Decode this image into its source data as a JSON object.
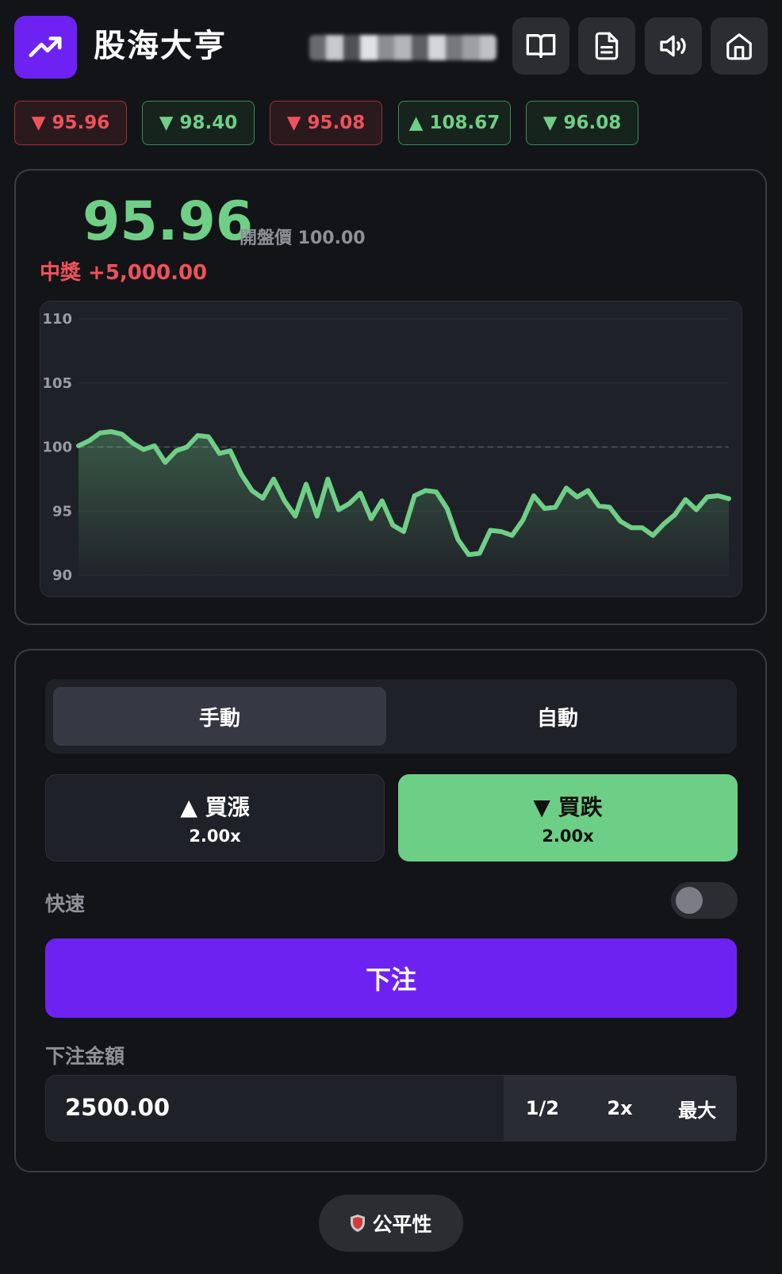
{
  "header": {
    "title": "股海大亨",
    "logo_icon": "trending-up-icon",
    "buttons": [
      {
        "icon": "book-open-icon"
      },
      {
        "icon": "document-icon"
      },
      {
        "icon": "volume-icon"
      },
      {
        "icon": "home-icon"
      }
    ]
  },
  "history": [
    {
      "text": "▼ 95.96",
      "dir": "down"
    },
    {
      "text": "▼ 98.40",
      "dir": "up"
    },
    {
      "text": "▼ 95.08",
      "dir": "down"
    },
    {
      "text": "▲ 108.67",
      "dir": "up"
    },
    {
      "text": "▼ 96.08",
      "dir": "up"
    }
  ],
  "price": {
    "current": "95.96",
    "open_label": "開盤價 100.00",
    "win_label": "中獎 +5,000.00"
  },
  "chart_data": {
    "type": "area",
    "ylim": [
      90,
      110
    ],
    "yticks": [
      "110",
      "105",
      "100",
      "95",
      "90"
    ],
    "reference_line": 100,
    "line_color": "#6fcf86",
    "values": [
      100.1,
      100.5,
      101.1,
      101.2,
      101.0,
      100.3,
      99.8,
      100.1,
      98.8,
      99.7,
      100.0,
      100.9,
      100.8,
      99.5,
      99.7,
      97.9,
      96.6,
      96.0,
      97.5,
      95.8,
      94.6,
      97.1,
      94.6,
      97.5,
      95.1,
      95.6,
      96.4,
      94.4,
      95.8,
      93.9,
      93.4,
      96.2,
      96.6,
      96.5,
      95.2,
      92.8,
      91.6,
      91.7,
      93.5,
      93.4,
      93.1,
      94.3,
      96.2,
      95.2,
      95.3,
      96.8,
      96.1,
      96.6,
      95.4,
      95.3,
      94.2,
      93.7,
      93.7,
      93.1,
      94.0,
      94.7,
      95.9,
      95.1,
      96.1,
      96.2,
      95.96
    ]
  },
  "mode_tabs": {
    "manual": "手動",
    "auto": "自動"
  },
  "direction": {
    "up_label": "▲ 買漲",
    "up_mult": "2.00x",
    "down_label": "▼ 買跌",
    "down_mult": "2.00x"
  },
  "fast_label": "快速",
  "bet_button": "下注",
  "bet_amount": {
    "label": "下注金額",
    "value": "2500.00",
    "half": "1/2",
    "double": "2x",
    "max": "最大"
  },
  "fairness": {
    "label": "公平性",
    "icon": "shield-icon"
  },
  "colors": {
    "accent": "#6e22f2",
    "up": "#6fcf86",
    "down": "#f0515b",
    "background": "#131418"
  }
}
